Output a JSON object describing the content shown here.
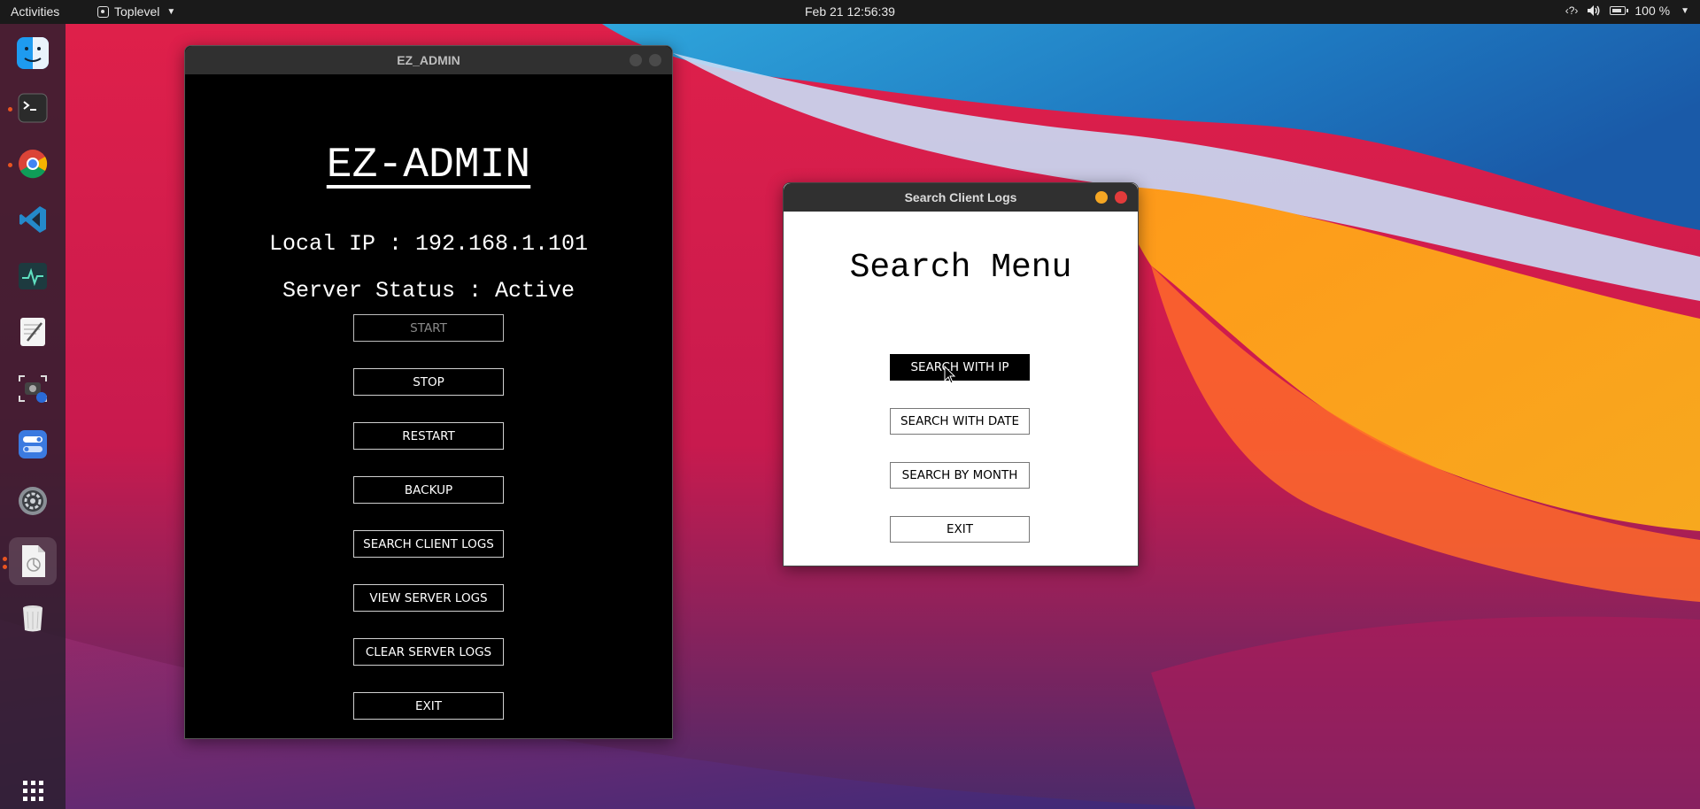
{
  "topbar": {
    "activities": "Activities",
    "app_menu": "Toplevel",
    "clock": "Feb 21  12:56:39",
    "battery": "100 %",
    "tray_icons": [
      "network-icon",
      "volume-icon",
      "battery-icon",
      "system-menu-chevron-icon"
    ]
  },
  "dock": {
    "items": [
      {
        "name": "finder",
        "running": false
      },
      {
        "name": "terminal",
        "running": true
      },
      {
        "name": "chrome",
        "running": true
      },
      {
        "name": "vscode",
        "running": false
      },
      {
        "name": "system-monitor",
        "running": false
      },
      {
        "name": "text-editor",
        "running": false
      },
      {
        "name": "screenshot",
        "running": false
      },
      {
        "name": "settings-toggle",
        "running": false
      },
      {
        "name": "system-preferences",
        "running": false
      },
      {
        "name": "document-viewer",
        "running": true,
        "active": true
      },
      {
        "name": "trash",
        "running": false
      }
    ],
    "show_apps": "grid-icon"
  },
  "ez_window": {
    "title": "EZ_ADMIN",
    "heading": "EZ-ADMIN",
    "local_ip": "Local IP : 192.168.1.101",
    "server_status": "Server Status : Active",
    "buttons": {
      "start": "START",
      "stop": "STOP",
      "restart": "RESTART",
      "backup": "BACKUP",
      "search_client_logs": "SEARCH CLIENT LOGS",
      "view_server_logs": "VIEW SERVER LOGS",
      "clear_server_logs": "CLEAR SERVER LOGS",
      "exit": "EXIT"
    }
  },
  "search_window": {
    "title": "Search Client Logs",
    "heading": "Search Menu",
    "buttons": {
      "search_with_ip": "SEARCH WITH IP",
      "search_with_date": "SEARCH WITH DATE",
      "search_by_month": "SEARCH BY MONTH",
      "exit": "EXIT"
    },
    "selected": "search_with_ip"
  },
  "colors": {
    "topbar_bg": "#1a1a1a",
    "ez_bg": "#000000",
    "search_bg": "#ffffff",
    "minimize": "#f5a623",
    "close": "#e23b3b"
  }
}
